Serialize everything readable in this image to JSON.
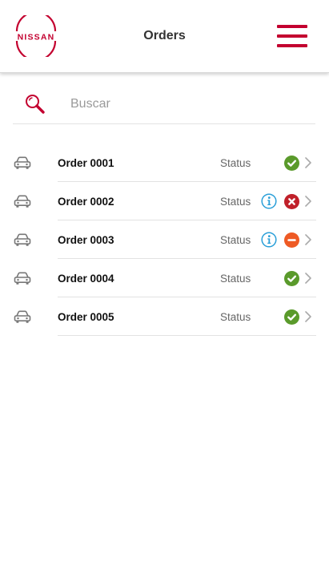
{
  "header": {
    "logo_text": "NISSAN",
    "title": "Orders",
    "menu_icon": "hamburger-menu-icon"
  },
  "search": {
    "placeholder": "Buscar",
    "value": "",
    "icon": "search-icon"
  },
  "colors": {
    "brand": "#c3002f",
    "success": "#5a9a2b",
    "error": "#c0202a",
    "warning": "#ee5a24",
    "info": "#2a9fd8"
  },
  "orders": [
    {
      "label": "Order 0001",
      "status_label": "Status",
      "status": "success",
      "info": false
    },
    {
      "label": "Order 0002",
      "status_label": "Status",
      "status": "error",
      "info": true
    },
    {
      "label": "Order 0003",
      "status_label": "Status",
      "status": "warning",
      "info": true
    },
    {
      "label": "Order 0004",
      "status_label": "Status",
      "status": "success",
      "info": false
    },
    {
      "label": "Order 0005",
      "status_label": "Status",
      "status": "success",
      "info": false
    }
  ]
}
